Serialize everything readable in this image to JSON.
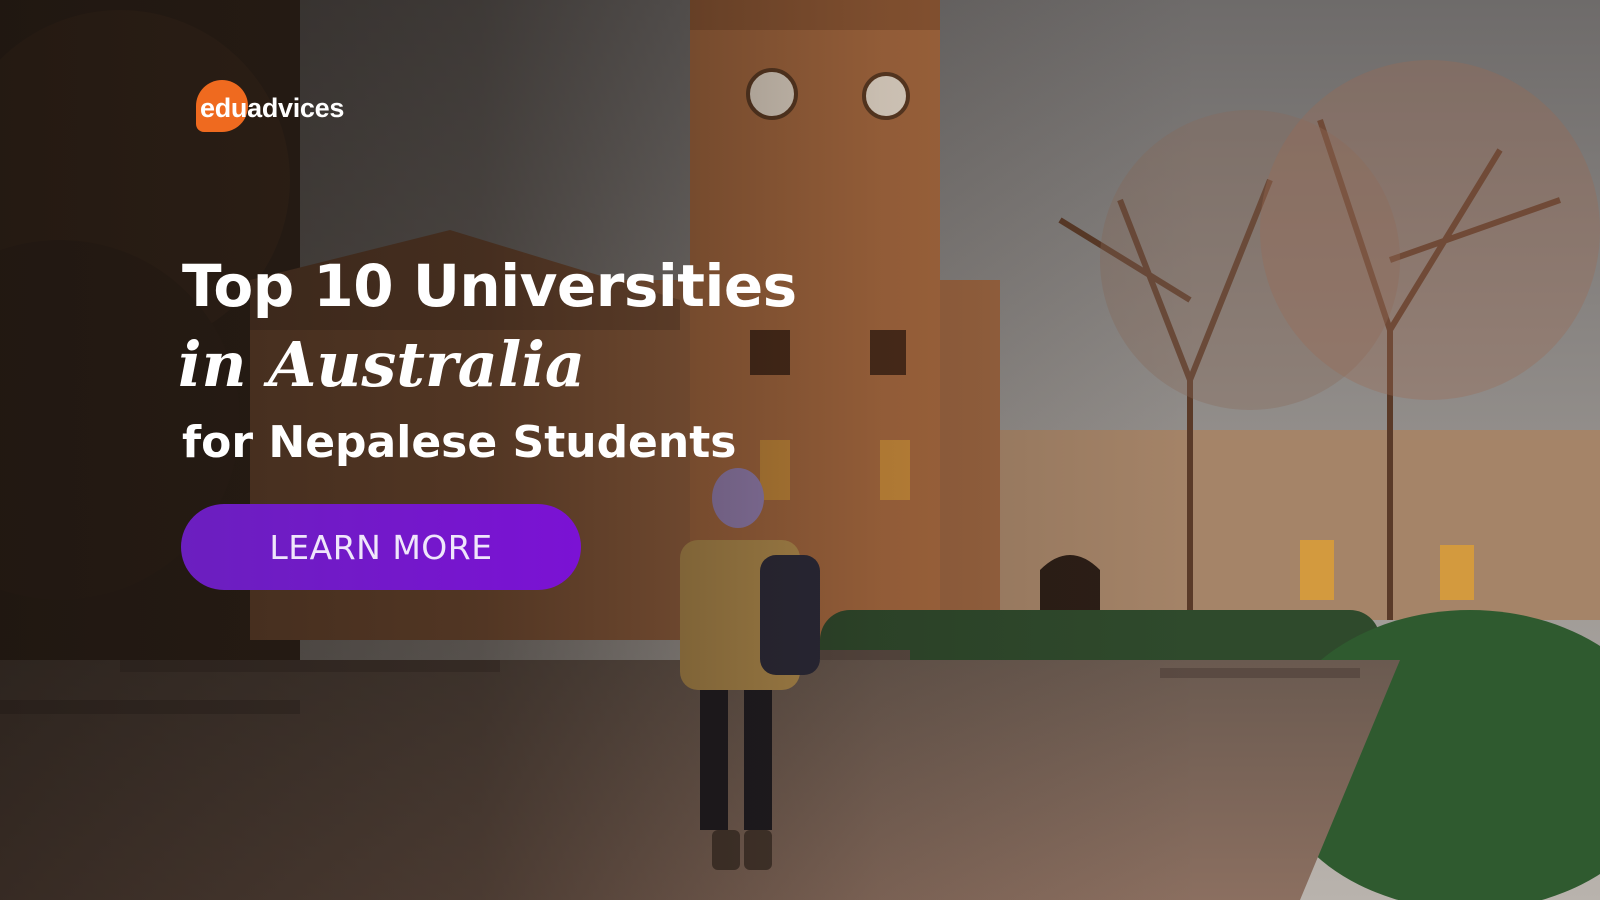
{
  "brand": {
    "logo_part1": "edu",
    "logo_part2": "advices",
    "accent_color": "#ef6a1f"
  },
  "headline": {
    "line1": "Top 10 Universities",
    "line2": "in Australia",
    "line3": "for Nepalese Students"
  },
  "cta": {
    "label": "LEARN MORE",
    "color": "#7b12d4"
  },
  "background": {
    "icon": "university-campus-photo"
  }
}
